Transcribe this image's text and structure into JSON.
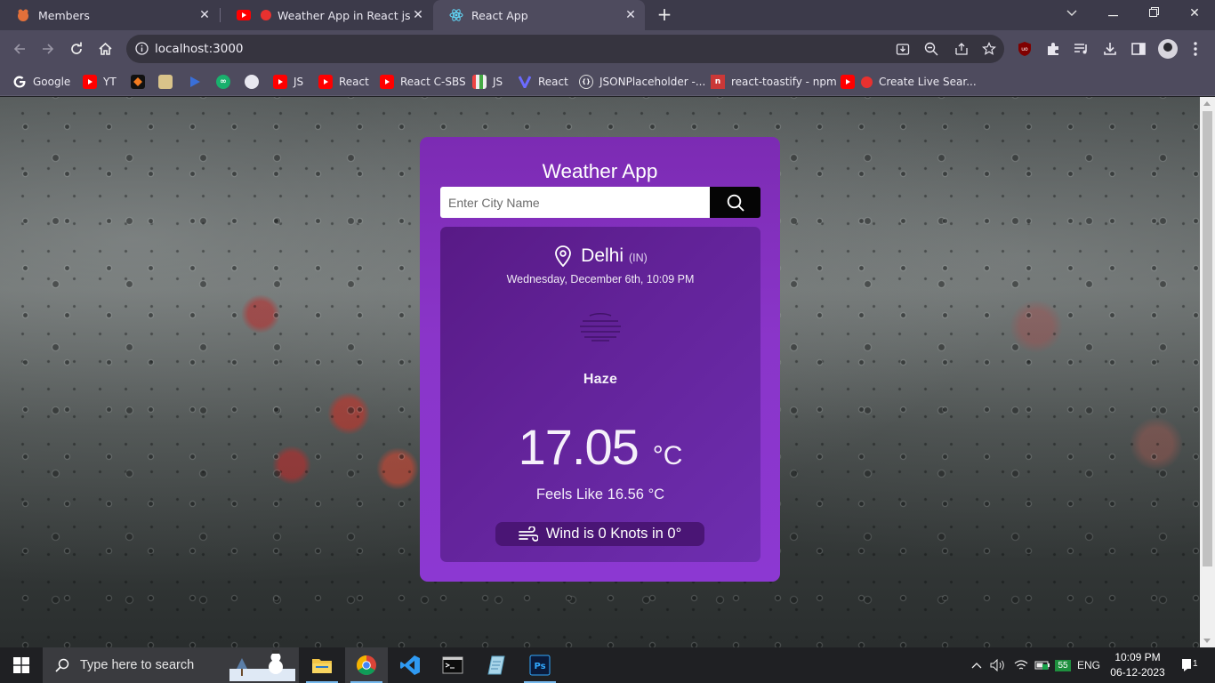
{
  "tabs": [
    {
      "title": "Members",
      "icon": "members-favicon"
    },
    {
      "title": "Weather App in React js Hindi",
      "icon": "youtube-favicon"
    },
    {
      "title": "React App",
      "icon": "react-favicon"
    }
  ],
  "address": {
    "url": "localhost:3000"
  },
  "bookmarks": [
    {
      "label": "Google",
      "icon": "google-icon"
    },
    {
      "label": "YT",
      "icon": "youtube-icon"
    },
    {
      "label": "",
      "icon": "bookmark-icon"
    },
    {
      "label": "",
      "icon": "bookmark-icon"
    },
    {
      "label": "",
      "icon": "bookmark-icon"
    },
    {
      "label": "",
      "icon": "bookmark-icon"
    },
    {
      "label": "",
      "icon": "bookmark-icon"
    },
    {
      "label": "JS",
      "icon": "youtube-icon"
    },
    {
      "label": "React",
      "icon": "youtube-icon"
    },
    {
      "label": "React C-SBS",
      "icon": "youtube-icon"
    },
    {
      "label": "JS",
      "icon": "bookmark-icon"
    },
    {
      "label": "React",
      "icon": "bookmark-icon"
    },
    {
      "label": "JSONPlaceholder -...",
      "icon": "bookmark-icon"
    },
    {
      "label": "react-toastify - npm",
      "icon": "npm-icon"
    },
    {
      "label": "Create Live Sear...",
      "icon": "youtube-icon"
    }
  ],
  "weather": {
    "app_title": "Weather App",
    "search_placeholder": "Enter City Name",
    "city": "Delhi",
    "country": "(IN)",
    "datetime": "Wednesday, December 6th, 10:09 PM",
    "condition": "Haze",
    "temperature": "17.05",
    "unit": "°C",
    "feels_like": "Feels Like 16.56 °C",
    "wind": "Wind is 0 Knots in 0°"
  },
  "taskbar": {
    "search_text": "Type here to search",
    "language": "ENG",
    "battery_badge": "55",
    "time": "10:09 PM",
    "date": "06-12-2023",
    "notification_count": "1"
  },
  "colors": {
    "card": "#8a35c9",
    "panel": "#63239a",
    "wind_pill": "#4a1575"
  }
}
